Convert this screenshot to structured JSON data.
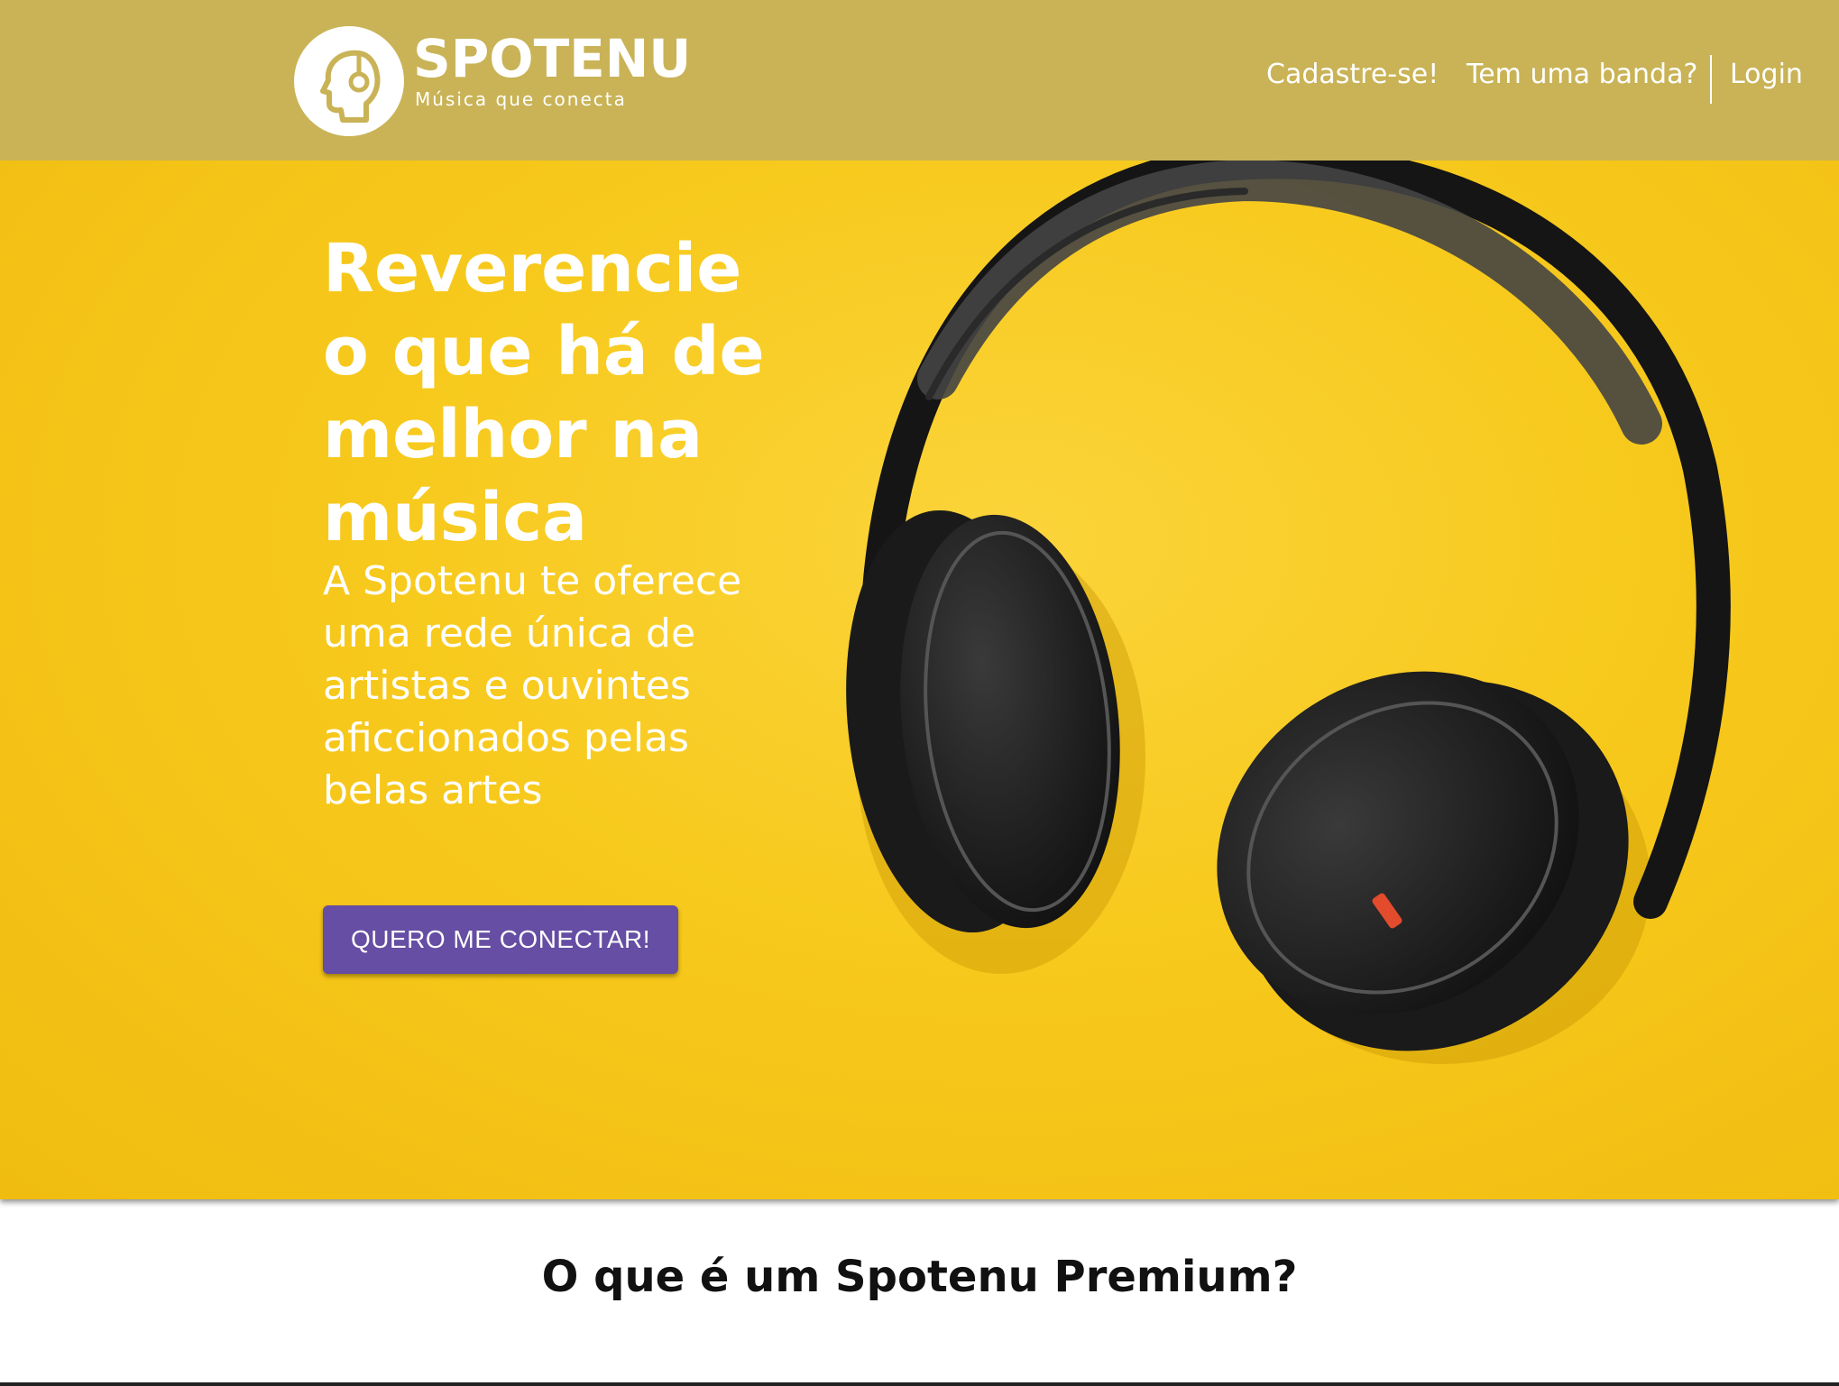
{
  "brand": {
    "name": "SPOTENU",
    "tagline": "Música que conecta"
  },
  "nav": {
    "signup": "Cadastre-se!",
    "band": "Tem uma banda?",
    "login": "Login"
  },
  "hero": {
    "title": "Reverencie o que há de melhor na música",
    "subtitle": "A Spotenu te oferece uma rede única de artistas e ouvintes aficcionados pelas belas artes",
    "cta": "QUERO ME CONECTAR!"
  },
  "premium_section": {
    "title": "O que é um Spotenu Premium?"
  },
  "colors": {
    "header": "#c9b356",
    "hero_background": "#f7c91c",
    "cta": "#654ea3",
    "text_light": "#ffffff",
    "text_dark": "#111111"
  }
}
